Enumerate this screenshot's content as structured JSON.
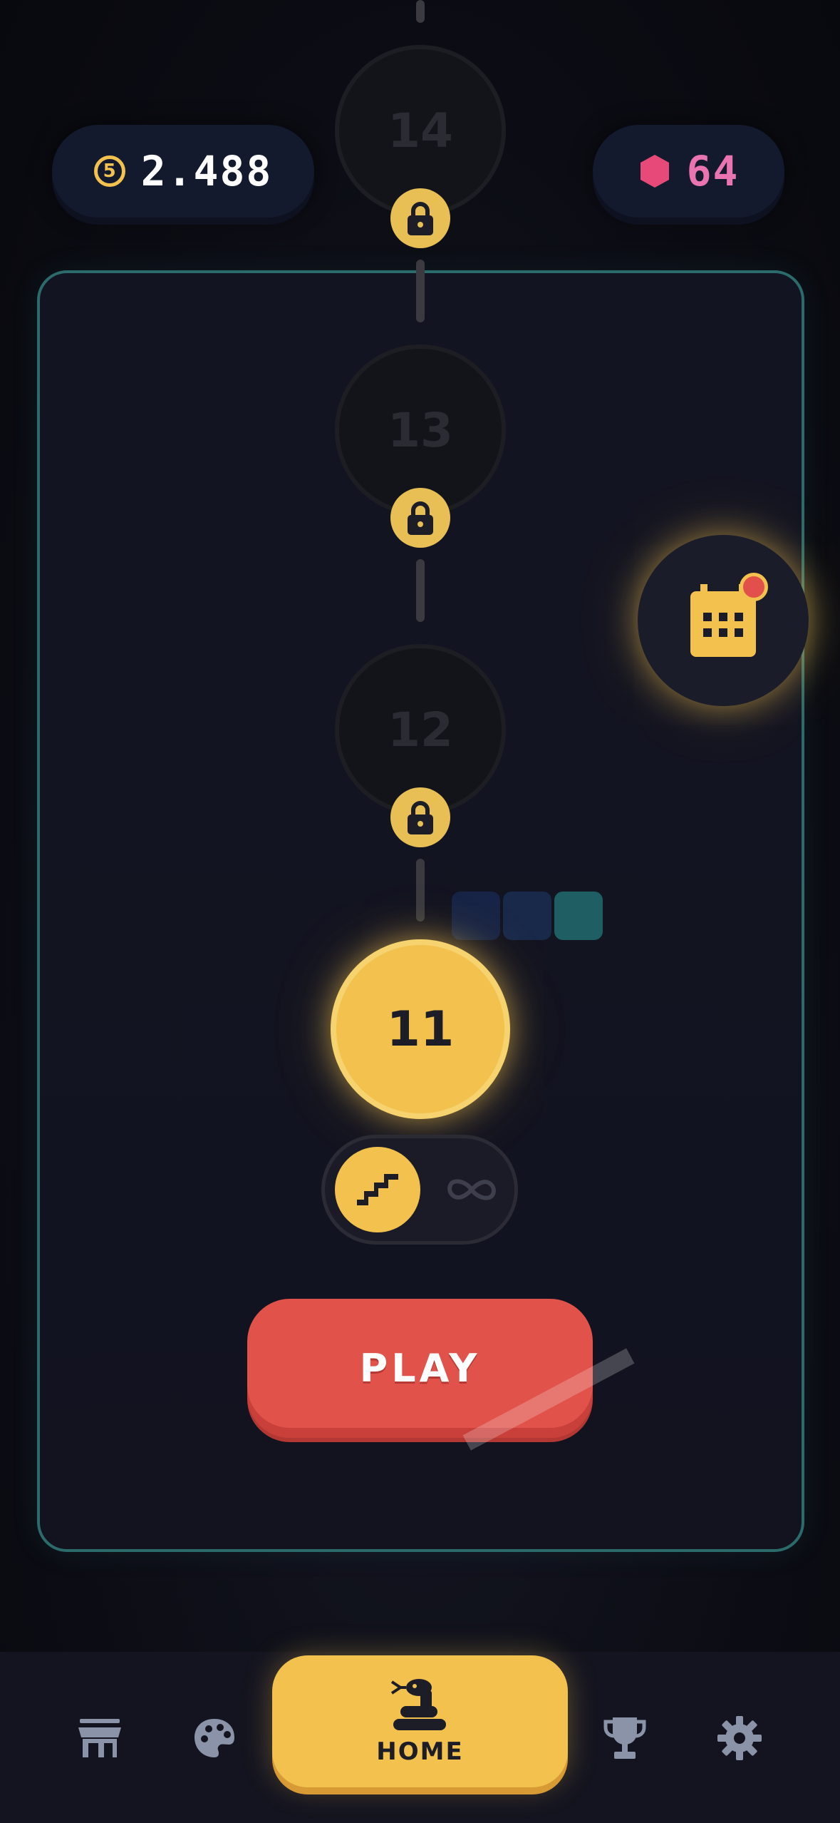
{
  "currency": {
    "coins_icon": "coin-icon",
    "coins_symbol": "5",
    "coins_value": "2.488",
    "gems_icon": "hexagon-gem-icon",
    "gems_value": "64"
  },
  "levels": {
    "locked": [
      {
        "number": "14",
        "icon": "lock-icon"
      },
      {
        "number": "13",
        "icon": "lock-icon"
      },
      {
        "number": "12",
        "icon": "lock-icon"
      }
    ],
    "current": {
      "number": "11"
    }
  },
  "mode_toggle": {
    "selected": "levels",
    "options": [
      "stairs-icon",
      "infinity-icon"
    ]
  },
  "daily": {
    "icon": "calendar-icon",
    "has_notification": true
  },
  "play": {
    "label": "PLAY"
  },
  "bottom_nav": {
    "items": [
      {
        "icon": "shop-icon"
      },
      {
        "icon": "palette-icon"
      },
      {
        "icon": "snake-icon",
        "label": "HOME",
        "active": true
      },
      {
        "icon": "trophy-icon"
      },
      {
        "icon": "gear-icon"
      }
    ]
  },
  "colors": {
    "accent": "#f2c14e",
    "play": "#e0524a",
    "gem": "#e74a78",
    "panel_border": "#2b6b6b",
    "background": "#0b0c12"
  }
}
